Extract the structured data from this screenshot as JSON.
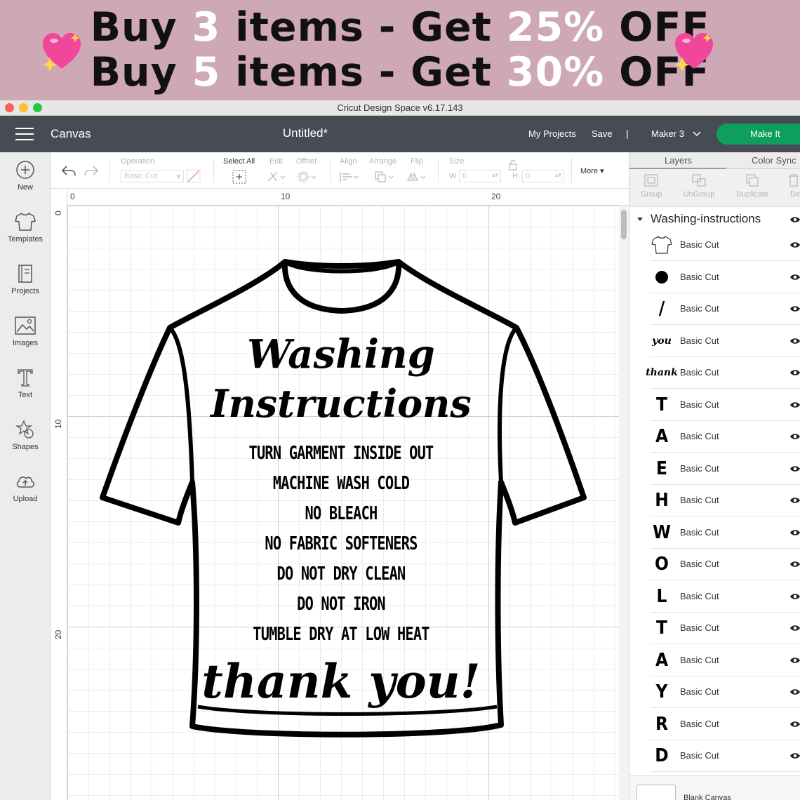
{
  "promo": {
    "line1": {
      "pre": "Buy ",
      "num": "3",
      "mid": " items - Get ",
      "pct": "25%",
      "post": " OFF"
    },
    "line2": {
      "pre": "Buy ",
      "num": "5",
      "mid": " items - Get ",
      "pct": "30%",
      "post": " OFF"
    },
    "icon": "sparkling-heart-icon",
    "colors": {
      "background": "#cfa8b8",
      "highlight": "#ffffff",
      "heart": "#f0479a"
    }
  },
  "window": {
    "title": "Cricut Design Space  v6.17.143",
    "traffic_lights": [
      "#fe5f57",
      "#febc2e",
      "#28c840"
    ]
  },
  "header": {
    "menu_icon": "hamburger-menu-icon",
    "section": "Canvas",
    "doc_title": "Untitled*",
    "my_projects": "My Projects",
    "save": "Save",
    "separator": "|",
    "machine": "Maker 3",
    "make_it": "Make It",
    "colors": {
      "bar": "#474c54",
      "make_it": "#0e9e5e"
    }
  },
  "sidebar": {
    "items": [
      {
        "label": "New",
        "icon": "plus-circle-icon"
      },
      {
        "label": "Templates",
        "icon": "tshirt-icon"
      },
      {
        "label": "Projects",
        "icon": "projects-icon"
      },
      {
        "label": "Images",
        "icon": "image-icon"
      },
      {
        "label": "Text",
        "icon": "text-t-icon"
      },
      {
        "label": "Shapes",
        "icon": "shapes-icon"
      },
      {
        "label": "Upload",
        "icon": "cloud-upload-icon"
      }
    ]
  },
  "toolbar": {
    "operation_label": "Operation",
    "operation_value": "Basic Cut",
    "select_all": "Select All",
    "edit": "Edit",
    "offset": "Offset",
    "align": "Align",
    "arrange": "Arrange",
    "flip": "Flip",
    "size": "Size",
    "w_label": "W",
    "w_value": "0",
    "h_label": "H",
    "h_value": "0",
    "more": "More"
  },
  "rulers": {
    "top": [
      "0",
      "10",
      "20"
    ],
    "left": [
      "0",
      "10",
      "20"
    ]
  },
  "design": {
    "title1": "Washing",
    "title2": "Instructions",
    "lines": [
      "TURN GARMENT INSIDE OUT",
      "MACHINE WASH COLD",
      "NO BLEACH",
      "NO FABRIC SOFTENERS",
      "DO NOT DRY CLEAN",
      "DO NOT IRON",
      "TUMBLE DRY AT LOW HEAT"
    ],
    "closing": "thank you!"
  },
  "panel": {
    "tabs": [
      "Layers",
      "Color Sync"
    ],
    "actions": [
      "Group",
      "UnGroup",
      "Duplicate",
      "Del"
    ],
    "group_name": "Washing-instructions",
    "layers": [
      {
        "thumb": "",
        "icon": "tshirt-outline-icon",
        "label": "Basic Cut"
      },
      {
        "thumb": "",
        "icon": "dot-icon",
        "label": "Basic Cut"
      },
      {
        "thumb": "/",
        "label": "Basic Cut"
      },
      {
        "thumb": "you",
        "label": "Basic Cut"
      },
      {
        "thumb": "thank",
        "label": "Basic Cut"
      },
      {
        "thumb": "T",
        "label": "Basic Cut"
      },
      {
        "thumb": "A",
        "label": "Basic Cut"
      },
      {
        "thumb": "E",
        "label": "Basic Cut"
      },
      {
        "thumb": "H",
        "label": "Basic Cut"
      },
      {
        "thumb": "W",
        "label": "Basic Cut"
      },
      {
        "thumb": "O",
        "label": "Basic Cut"
      },
      {
        "thumb": "L",
        "label": "Basic Cut"
      },
      {
        "thumb": "T",
        "label": "Basic Cut"
      },
      {
        "thumb": "A",
        "label": "Basic Cut"
      },
      {
        "thumb": "Y",
        "label": "Basic Cut"
      },
      {
        "thumb": "R",
        "label": "Basic Cut"
      },
      {
        "thumb": "D",
        "label": "Basic Cut"
      }
    ],
    "blank_canvas": "Blank Canvas"
  }
}
